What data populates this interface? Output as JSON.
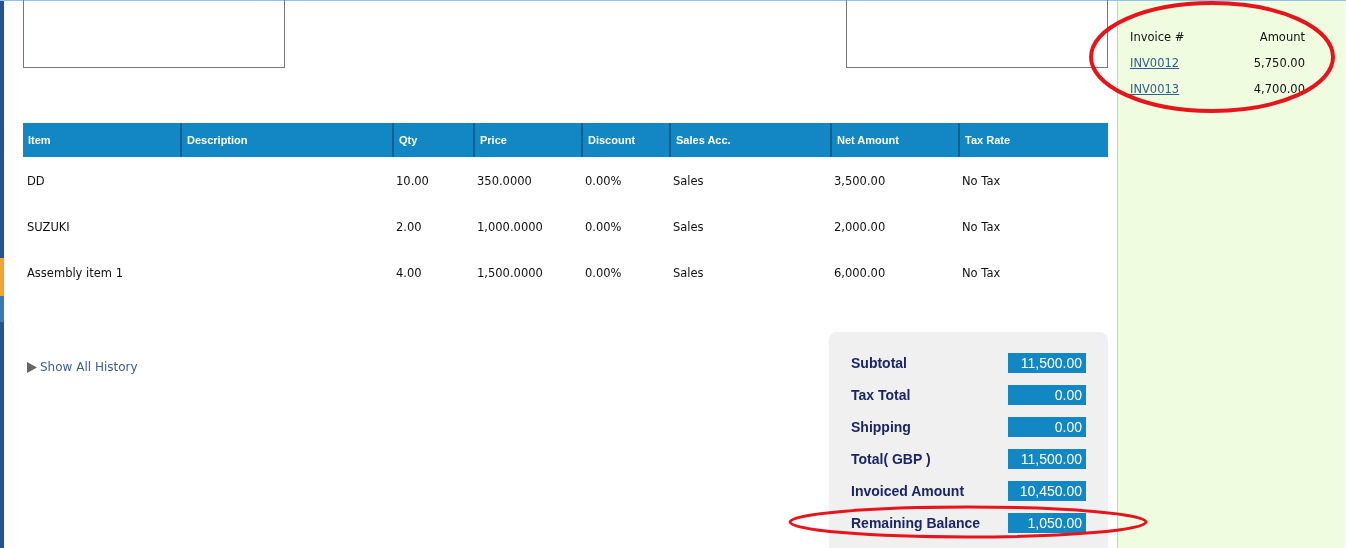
{
  "invoices_panel": {
    "columns": [
      "Invoice #",
      "Amount"
    ],
    "rows": [
      {
        "invoice": "INV0012",
        "amount": "5,750.00"
      },
      {
        "invoice": "INV0013",
        "amount": "4,700.00"
      }
    ]
  },
  "items_table": {
    "columns": [
      "Item",
      "Description",
      "Qty",
      "Price",
      "Discount",
      "Sales Acc.",
      "Net Amount",
      "Tax Rate"
    ],
    "rows": [
      [
        "DD",
        "",
        "10.00",
        "350.0000",
        "0.00%",
        "Sales",
        "3,500.00",
        "No Tax"
      ],
      [
        "SUZUKI",
        "",
        "2.00",
        "1,000.0000",
        "0.00%",
        "Sales",
        "2,000.00",
        "No Tax"
      ],
      [
        "Assembly item 1",
        "",
        "4.00",
        "1,500.0000",
        "0.00%",
        "Sales",
        "6,000.00",
        "No Tax"
      ]
    ]
  },
  "history_link": "Show All History",
  "totals": [
    {
      "label": "Subtotal",
      "value": "11,500.00"
    },
    {
      "label": "Tax Total",
      "value": "0.00"
    },
    {
      "label": "Shipping",
      "value": "0.00"
    },
    {
      "label": "Total( GBP )",
      "value": "11,500.00"
    },
    {
      "label": "Invoiced Amount",
      "value": "10,450.00"
    },
    {
      "label": "Remaining Balance",
      "value": "1,050.00"
    }
  ]
}
